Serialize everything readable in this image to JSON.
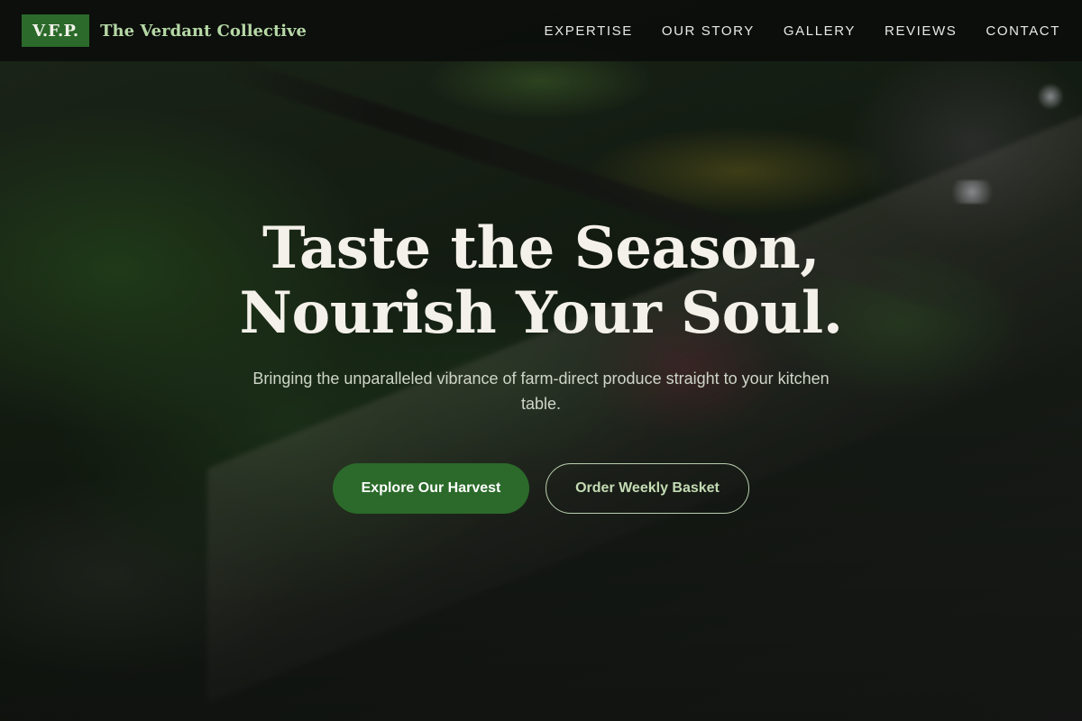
{
  "brand": {
    "badge": "V.F.P.",
    "name": "The Verdant Collective"
  },
  "nav": {
    "items": [
      {
        "label": "EXPERTISE"
      },
      {
        "label": "OUR STORY"
      },
      {
        "label": "GALLERY"
      },
      {
        "label": "REVIEWS"
      },
      {
        "label": "CONTACT"
      }
    ]
  },
  "hero": {
    "title_line1": "Taste the Season,",
    "title_line2": "Nourish Your Soul.",
    "subtitle": "Bringing the unparalleled vibrance of farm-direct produce straight to your kitchen table.",
    "primary_cta": "Explore Our Harvest",
    "secondary_cta": "Order Weekly Basket"
  },
  "colors": {
    "brand_green": "#2b6a2a",
    "brand_name_text": "#b6d8a6",
    "navbar_bg": "#0a0c0a",
    "title_text": "#f4f1ea"
  }
}
